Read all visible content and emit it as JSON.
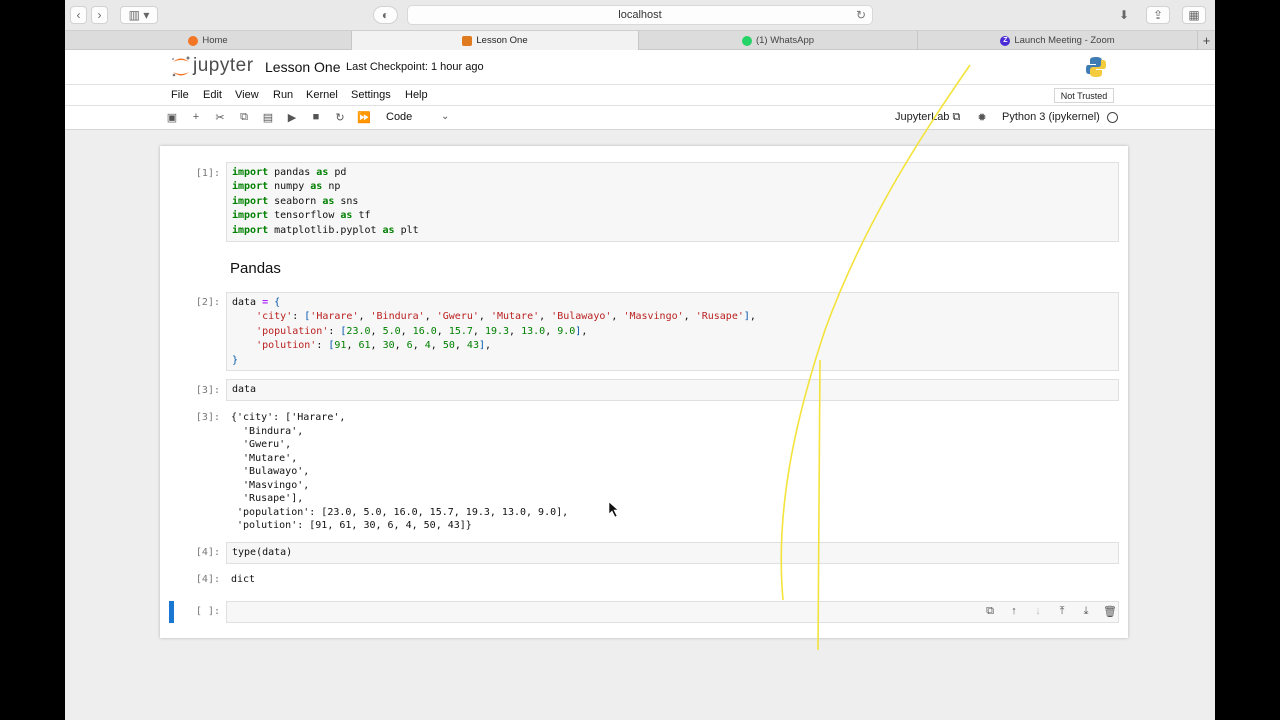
{
  "browser": {
    "url": "localhost",
    "tabs": [
      {
        "label": "Home",
        "active": false
      },
      {
        "label": "Lesson One",
        "active": true
      },
      {
        "label": "(1) WhatsApp",
        "active": false
      },
      {
        "label": "Launch Meeting - Zoom",
        "active": false
      }
    ],
    "new_tab_label": "+"
  },
  "header": {
    "logo_text": "jupyter",
    "notebook_title": "Lesson One",
    "checkpoint": "Last Checkpoint: 1 hour ago"
  },
  "menu": [
    "File",
    "Edit",
    "View",
    "Run",
    "Kernel",
    "Settings",
    "Help"
  ],
  "trust_label": "Not Trusted",
  "toolbar": {
    "cell_type": "Code",
    "jupyterlab_label": "JupyterLab",
    "kernel": "Python 3 (ipykernel)"
  },
  "cells": {
    "c1_prompt": "[1]:",
    "c2_prompt": "[2]:",
    "c3_prompt": "[3]:",
    "c3_out_prompt": "[3]:",
    "c4_prompt": "[4]:",
    "c4_out_prompt": "[4]:",
    "c5_prompt": "[ ]:",
    "markdown_heading": "Pandas",
    "c3_code": "data",
    "c4_code": "type(data)",
    "c4_output": "dict",
    "c3_output": "{'city': ['Harare',\n  'Bindura',\n  'Gweru',\n  'Mutare',\n  'Bulawayo',\n  'Masvingo',\n  'Rusape'],\n 'population': [23.0, 5.0, 16.0, 15.7, 19.3, 13.0, 9.0],\n 'polution': [91, 61, 30, 6, 4, 50, 43]}"
  },
  "colors": {
    "accent": "#1976d2",
    "annotation": "#f3e33b",
    "keyword": "#008000",
    "string": "#ba2121"
  }
}
